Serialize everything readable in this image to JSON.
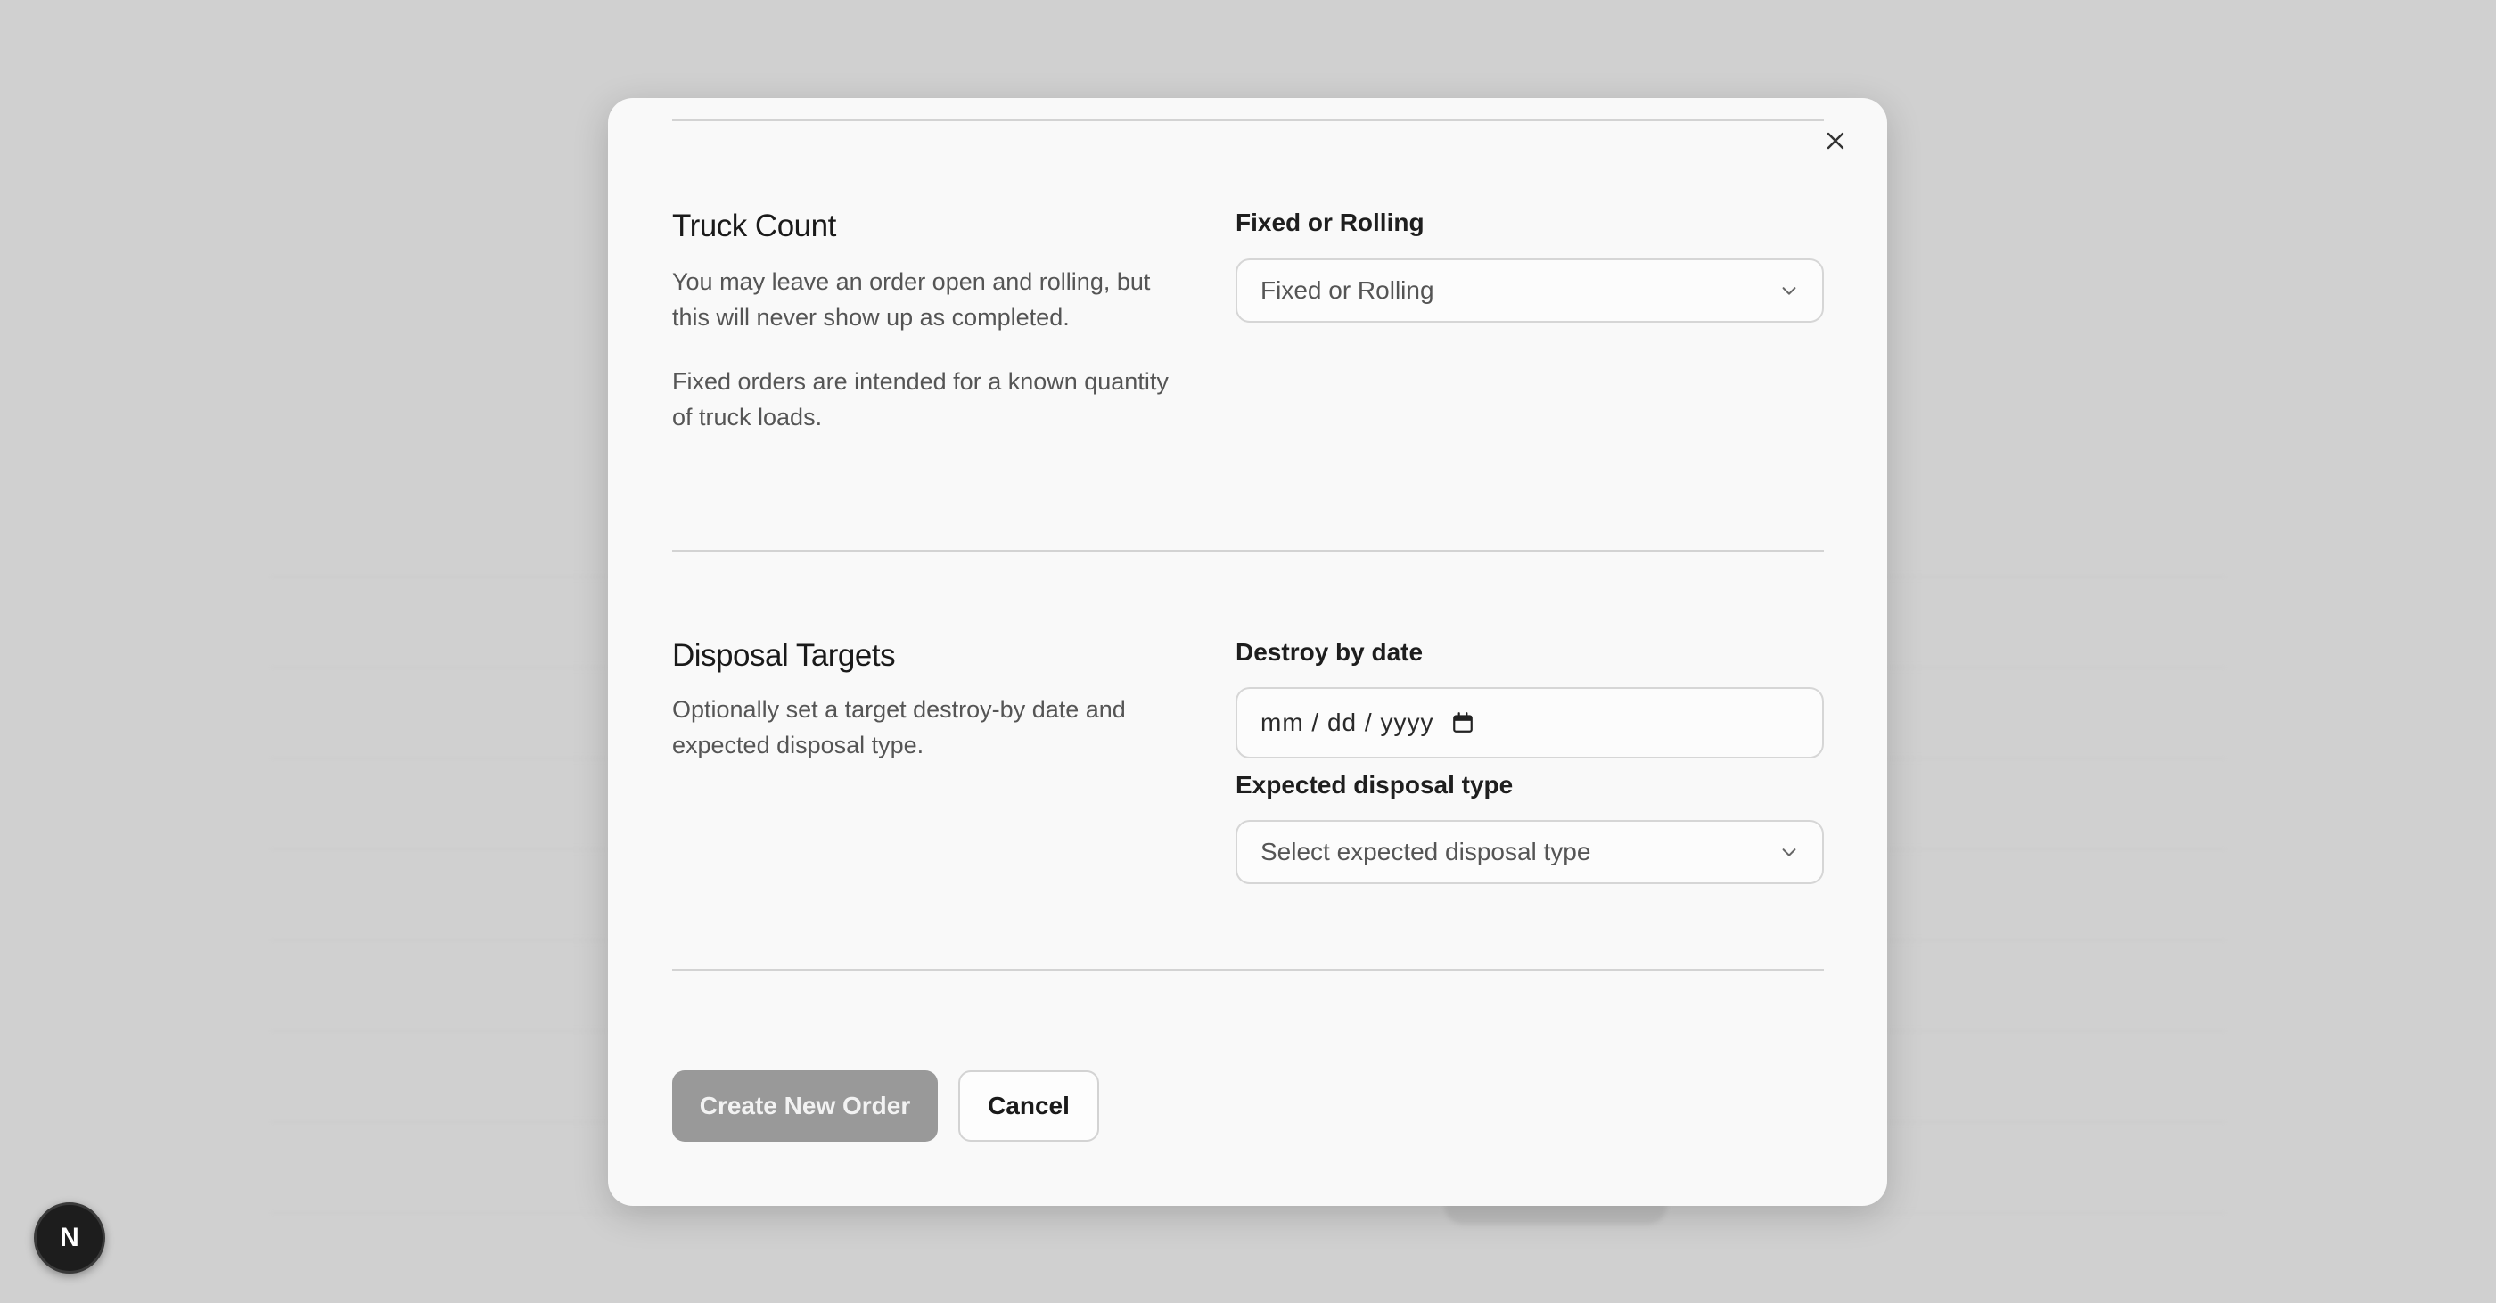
{
  "modal": {
    "truck_count": {
      "title": "Truck Count",
      "desc1": "You may leave an order open and rolling, but this will never show up as completed.",
      "desc2": "Fixed orders are intended for a known quantity of truck loads.",
      "field_label": "Fixed or Rolling",
      "select_value": "Fixed or Rolling"
    },
    "disposal_targets": {
      "title": "Disposal Targets",
      "desc": "Optionally set a target destroy-by date and expected disposal type.",
      "date_label": "Destroy by date",
      "date_placeholder": "mm / dd / yyyy",
      "type_label": "Expected disposal type",
      "type_placeholder": "Select expected disposal type"
    },
    "actions": {
      "create_label": "Create New Order",
      "cancel_label": "Cancel"
    }
  },
  "badge": {
    "label": "N"
  },
  "icons": {
    "close": "close-icon",
    "chevron": "chevron-down-icon",
    "calendar": "calendar-icon"
  }
}
